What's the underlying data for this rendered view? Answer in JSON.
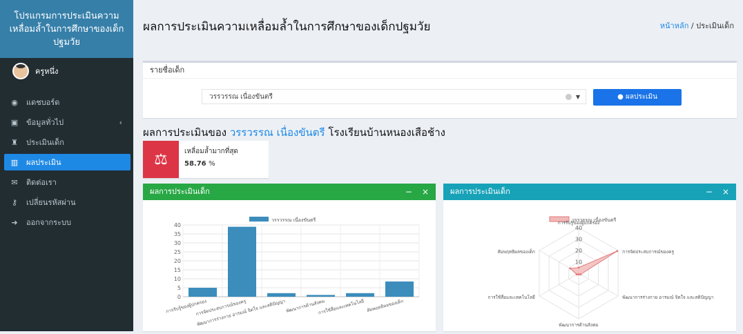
{
  "sidebar": {
    "brand": "โปรแกรมการประเมินความเหลื่อมล้ำในการศึกษาของเด็กปฐมวัย",
    "user_name": "ครูหนึ่ง",
    "items": [
      {
        "label": "แดชบอร์ด",
        "icon": "dashboard-icon"
      },
      {
        "label": "ข้อมูลทั่วไป",
        "icon": "id-card-icon"
      },
      {
        "label": "ประเมินเด็ก",
        "icon": "trophy-icon"
      },
      {
        "label": "ผลประเมิน",
        "icon": "table-icon"
      },
      {
        "label": "ติดต่อเรา",
        "icon": "envelope-icon"
      },
      {
        "label": "เปลี่ยนรหัสผ่าน",
        "icon": "key-icon"
      },
      {
        "label": "ออกจากระบบ",
        "icon": "sign-out-icon"
      }
    ]
  },
  "header": {
    "title": "ผลการประเมินความเหลื่อมล้ำในการศึกษาของเด็กปฐมวัย",
    "breadcrumb_home": "หน้าหลัก",
    "breadcrumb_sep": "/",
    "breadcrumb_current": "ประเมินเด็ก"
  },
  "student_box": {
    "title": "รายชื่อเด็ก",
    "selected": "วรรวรรณ เนื่องขันตรี",
    "button": "ผลประเมิน"
  },
  "result": {
    "prefix": "ผลการประเมินของ",
    "name": "วรรวรรณ เนื่องขันตรี",
    "school": "โรงเรียนบ้านหนองเสือช้าง",
    "stat_label": "เหลื่อมล้ำมากที่สุด",
    "stat_value": "58.76",
    "stat_unit": "%"
  },
  "panels": {
    "bar_title": "ผลการประเมินเด็ก",
    "radar_title": "ผลการประเมินเด็ก",
    "minimize": "−",
    "close": "×"
  },
  "colors": {
    "bar": "#3c8dbc",
    "radar_fill": "#f2b8b8",
    "radar_stroke": "#e07b7b"
  },
  "chart_data": [
    {
      "type": "bar",
      "legend": "วรรวรรณ เนื่องขันตรี",
      "categories": [
        "การรับรู้ของผู้ปกครอง",
        "การจัดประสบการณ์ของครู",
        "พัฒนาการร่างกาย อารมณ์ จิตใจ และสติปัญญา",
        "พัฒนาการด้านสังคม",
        "การใช้สื่อและเทคโนโลยี",
        "สัมพฤทธิผลของเด็ก"
      ],
      "values": [
        5,
        39,
        2,
        1,
        2,
        8.5
      ],
      "ylim": [
        0,
        40
      ],
      "yticks": [
        0,
        5,
        10,
        15,
        20,
        25,
        30,
        35,
        40
      ]
    },
    {
      "type": "radar",
      "legend": "วรรวรรณ เนื่องขันตรี",
      "categories": [
        "การรับรู้ของผู้ปกครอง",
        "การจัดประสบการณ์ของครู",
        "พัฒนาการร่างกาย อารมณ์ จิตใจ และสติปัญญา",
        "พัฒนาการด้านสังคม",
        "การใช้สื่อและเทคโนโลยี",
        "สัมพฤทธิผลของเด็ก"
      ],
      "values": [
        5,
        39,
        2,
        1,
        2,
        8.5
      ],
      "rlim": [
        0,
        40
      ],
      "ticks": [
        10,
        20,
        30,
        40
      ]
    }
  ]
}
